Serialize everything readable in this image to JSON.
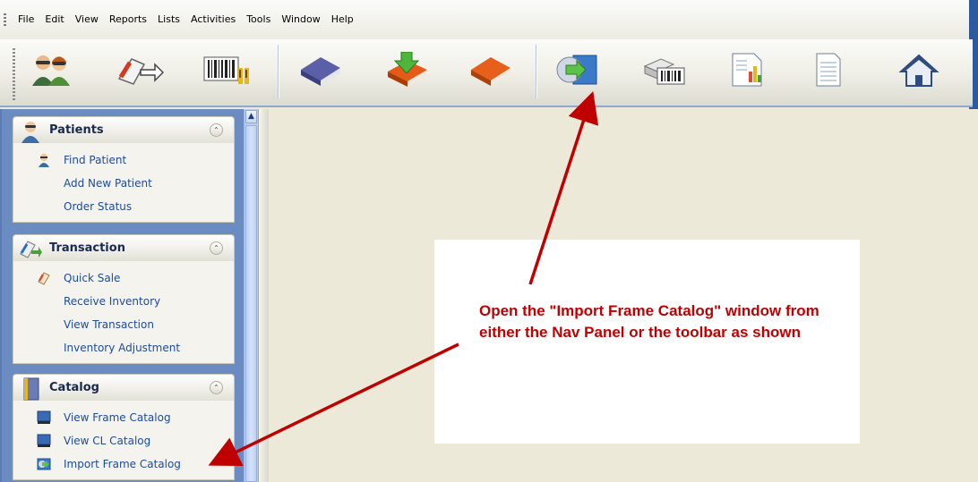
{
  "menubar": {
    "items": [
      "File",
      "Edit",
      "View",
      "Reports",
      "Lists",
      "Activities",
      "Tools",
      "Window",
      "Help"
    ]
  },
  "toolbar": {
    "buttons": [
      {
        "icon": "patients-icon"
      },
      {
        "icon": "transaction-icon"
      },
      {
        "icon": "barcode-icon"
      },
      {
        "icon": "blue-book-icon"
      },
      {
        "icon": "book-download-icon"
      },
      {
        "icon": "red-book-icon"
      },
      {
        "icon": "import-catalog-icon"
      },
      {
        "icon": "label-printer-icon"
      },
      {
        "icon": "chart-report-icon"
      },
      {
        "icon": "document-icon"
      },
      {
        "icon": "home-icon"
      }
    ]
  },
  "nav": {
    "patients": {
      "title": "Patients",
      "items": [
        "Find Patient",
        "Add New Patient",
        "Order Status"
      ]
    },
    "transaction": {
      "title": "Transaction",
      "items": [
        "Quick Sale",
        "Receive Inventory",
        "View Transaction",
        "Inventory Adjustment"
      ]
    },
    "catalog": {
      "title": "Catalog",
      "items": [
        "View Frame Catalog",
        "View CL Catalog",
        "Import Frame Catalog"
      ]
    }
  },
  "callout": {
    "text": "Open the \"Import Frame Catalog\" window from either the Nav Panel or the toolbar as shown",
    "color": "#c00000"
  },
  "colors": {
    "nav_panel": "#6b8cc2",
    "link": "#1f4b9b",
    "arrow": "#c00000"
  }
}
